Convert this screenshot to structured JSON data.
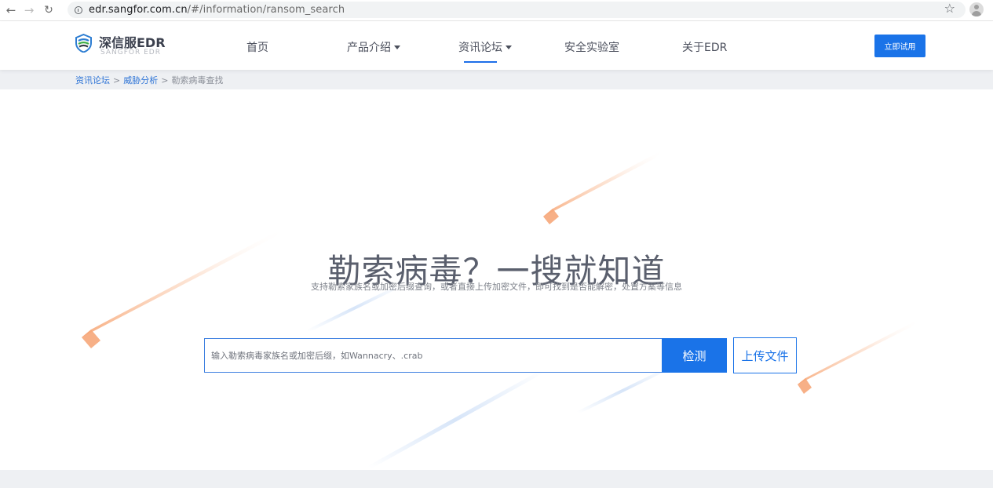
{
  "browser": {
    "url_host": "edr.sangfor.com.cn",
    "url_path": "/#/information/ransom_search",
    "icons": [
      "back-icon",
      "forward-icon",
      "reload-icon",
      "info-icon",
      "star-icon",
      "profile-icon"
    ]
  },
  "header": {
    "logo_title": "深信服EDR",
    "logo_subtitle": "SANGFOR EDR",
    "nav": [
      {
        "label": "首页"
      },
      {
        "label": "产品介绍"
      },
      {
        "label": "资讯论坛",
        "active": true
      },
      {
        "label": "安全实验室"
      },
      {
        "label": "关于EDR"
      }
    ],
    "trial_button": "立即试用"
  },
  "breadcrumb": {
    "items": [
      "资讯论坛",
      "威胁分析",
      "勒索病毒查找"
    ],
    "separator": ">"
  },
  "hero": {
    "title": "勒索病毒？一搜就知道",
    "subtitle": "支持勒索家族名或加密后缀查询，或者直接上传加密文件，即可找到是否能解密，处置方案等信息",
    "search_placeholder": "输入勒索病毒家族名或加密后缀，如Wannacry、.crab",
    "search_value": "",
    "detect_button": "检测",
    "upload_button": "上传文件"
  },
  "colors": {
    "accent": "#1a73e8",
    "breadcrumb_bg": "#eef0f3",
    "title_text": "#5a5f6d"
  }
}
